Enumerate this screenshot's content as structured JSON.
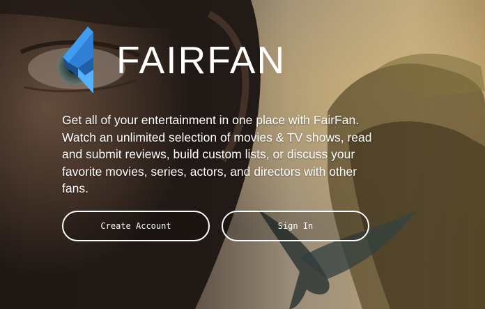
{
  "brand": {
    "name": "FAIRFAN",
    "accent_color": "#3f9cf0",
    "logo_icon": "fairfan-bolt-icon"
  },
  "hero": {
    "tagline": "Get all of your entertainment in one place with FairFan. Watch an unlimited selection of movies & TV shows, read and submit reviews, build custom lists, or discuss your favorite movies, series, actors, and directors with other fans."
  },
  "actions": {
    "create_account_label": "Create Account",
    "sign_in_label": "Sign In"
  }
}
